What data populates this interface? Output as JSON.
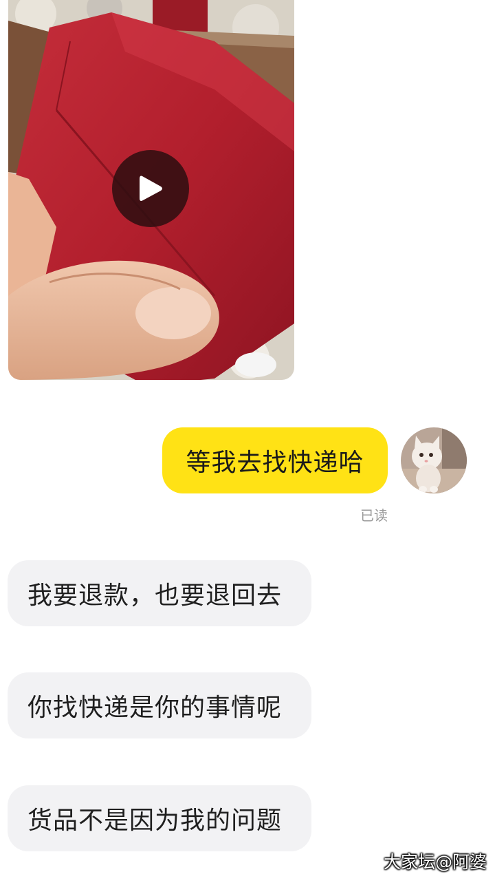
{
  "messages": [
    {
      "type": "video",
      "side": "incoming",
      "thumbnail_icon": "red-gift-box-in-hand",
      "play_icon": "play-icon"
    },
    {
      "type": "text",
      "side": "outgoing",
      "text": "等我去找快递哈",
      "status": "已读",
      "bubble_color": "#ffe215",
      "avatar_icon": "cat-avatar"
    },
    {
      "type": "text",
      "side": "incoming",
      "text": "我要退款，也要退回去",
      "bubble_color": "#f2f2f4"
    },
    {
      "type": "text",
      "side": "incoming",
      "text": "你找快递是你的事情呢",
      "bubble_color": "#f2f2f4"
    },
    {
      "type": "text",
      "side": "incoming",
      "text": "货品不是因为我的问题",
      "bubble_color": "#f2f2f4"
    }
  ],
  "watermark": "大家坛@阿婆"
}
